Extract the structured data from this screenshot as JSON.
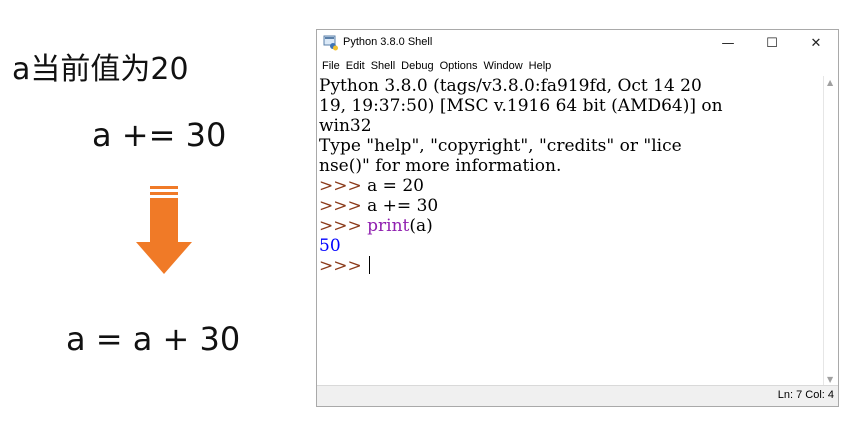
{
  "annotation": {
    "title": "a当前值为20",
    "expression": "a += 30",
    "equivalent": "a = a + 30",
    "arrow_color": "#f07a27"
  },
  "window": {
    "title": "Python 3.8.0 Shell",
    "controls": {
      "minimize": "—",
      "maximize": "☐",
      "close": "✕"
    },
    "menu": [
      "File",
      "Edit",
      "Shell",
      "Debug",
      "Options",
      "Window",
      "Help"
    ],
    "shell_lines": [
      "Python 3.8.0 (tags/v3.8.0:fa919fd, Oct 14 20",
      "19, 19:37:50) [MSC v.1916 64 bit (AMD64)] on",
      "win32",
      "Type \"help\", \"copyright\", \"credits\" or \"lice",
      "nse()\" for more information."
    ],
    "prompt": ">>>",
    "commands": [
      "a = 20",
      "a += 30"
    ],
    "print_keyword": "print",
    "print_args": "(a)",
    "output": "50",
    "status": "Ln: 7  Col: 4",
    "colors": {
      "prompt": "#8b3a1a",
      "builtin": "#9020b0",
      "stdout": "#0000ff"
    }
  }
}
